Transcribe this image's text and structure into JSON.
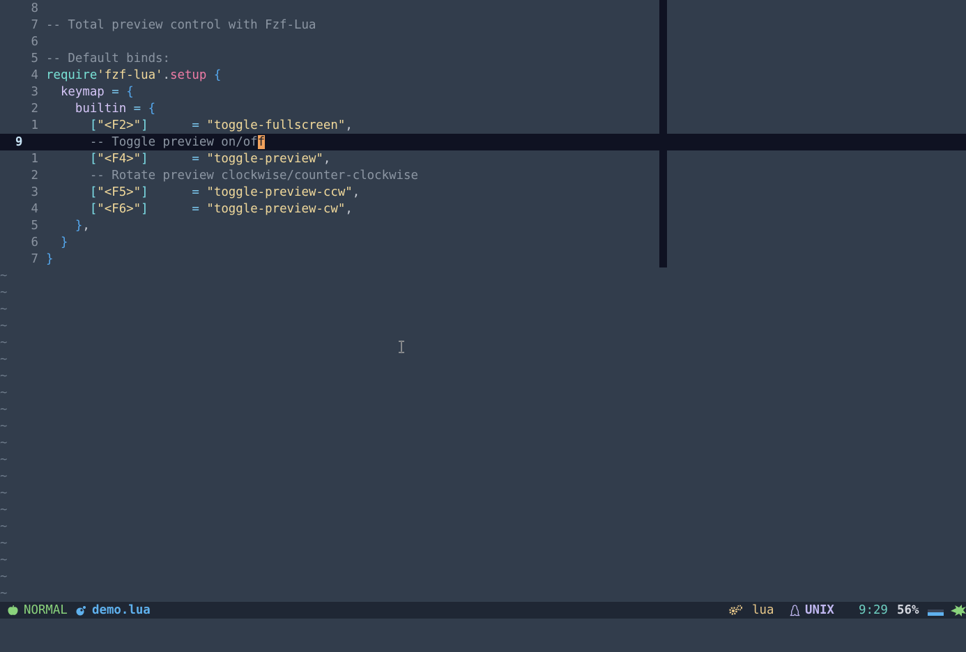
{
  "editor": {
    "lines": [
      {
        "num": "8",
        "segments": []
      },
      {
        "num": "7",
        "segments": [
          {
            "t": "-- Total preview control with Fzf-Lua",
            "c": "c-com"
          }
        ]
      },
      {
        "num": "6",
        "segments": []
      },
      {
        "num": "5",
        "segments": [
          {
            "t": "-- Default binds:",
            "c": "c-com"
          }
        ]
      },
      {
        "num": "4",
        "segments": [
          {
            "t": "require",
            "c": "c-kw"
          },
          {
            "t": "'fzf-lua'",
            "c": "c-str"
          },
          {
            "t": ".",
            "c": "c-pu"
          },
          {
            "t": "setup",
            "c": "c-fn"
          },
          {
            "t": " ",
            "c": "c-pu"
          },
          {
            "t": "{",
            "c": "c-br"
          }
        ]
      },
      {
        "num": "3",
        "segments": [
          {
            "t": "  keymap",
            "c": "c-var"
          },
          {
            "t": " = ",
            "c": "c-op"
          },
          {
            "t": "{",
            "c": "c-br"
          }
        ]
      },
      {
        "num": "2",
        "segments": [
          {
            "t": "    builtin",
            "c": "c-var"
          },
          {
            "t": " = ",
            "c": "c-op"
          },
          {
            "t": "{",
            "c": "c-br"
          }
        ]
      },
      {
        "num": "1",
        "segments": [
          {
            "t": "      [",
            "c": "c-bk"
          },
          {
            "t": "\"<F2>\"",
            "c": "c-str"
          },
          {
            "t": "]",
            "c": "c-bk"
          },
          {
            "t": "      = ",
            "c": "c-op"
          },
          {
            "t": "\"toggle-fullscreen\"",
            "c": "c-str"
          },
          {
            "t": ",",
            "c": "c-pu"
          }
        ]
      },
      {
        "num": "9",
        "current": true,
        "segments": [
          {
            "t": "      -- Toggle preview on/of",
            "c": "c-com"
          },
          {
            "t": "f",
            "c": "cursor"
          }
        ]
      },
      {
        "num": "1",
        "segments": [
          {
            "t": "      [",
            "c": "c-bk"
          },
          {
            "t": "\"<F4>\"",
            "c": "c-str"
          },
          {
            "t": "]",
            "c": "c-bk"
          },
          {
            "t": "      = ",
            "c": "c-op"
          },
          {
            "t": "\"toggle-preview\"",
            "c": "c-str"
          },
          {
            "t": ",",
            "c": "c-pu"
          }
        ]
      },
      {
        "num": "2",
        "segments": [
          {
            "t": "      -- Rotate preview clockwise/counter-clockwise",
            "c": "c-com"
          }
        ]
      },
      {
        "num": "3",
        "segments": [
          {
            "t": "      [",
            "c": "c-bk"
          },
          {
            "t": "\"<F5>\"",
            "c": "c-str"
          },
          {
            "t": "]",
            "c": "c-bk"
          },
          {
            "t": "      = ",
            "c": "c-op"
          },
          {
            "t": "\"toggle-preview-ccw\"",
            "c": "c-str"
          },
          {
            "t": ",",
            "c": "c-pu"
          }
        ]
      },
      {
        "num": "4",
        "segments": [
          {
            "t": "      [",
            "c": "c-bk"
          },
          {
            "t": "\"<F6>\"",
            "c": "c-str"
          },
          {
            "t": "]",
            "c": "c-bk"
          },
          {
            "t": "      = ",
            "c": "c-op"
          },
          {
            "t": "\"toggle-preview-cw\"",
            "c": "c-str"
          },
          {
            "t": ",",
            "c": "c-pu"
          }
        ]
      },
      {
        "num": "5",
        "segments": [
          {
            "t": "    }",
            "c": "c-br"
          },
          {
            "t": ",",
            "c": "c-pu"
          }
        ]
      },
      {
        "num": "6",
        "segments": [
          {
            "t": "  }",
            "c": "c-br"
          }
        ]
      },
      {
        "num": "7",
        "segments": [
          {
            "t": "}",
            "c": "c-br"
          }
        ]
      }
    ],
    "tilde_char": "~",
    "tilde_count": 20
  },
  "statusline": {
    "mode": "NORMAL",
    "filename": "demo.lua",
    "filetype": "lua",
    "fileformat": "UNIX",
    "position": "9:29",
    "percent": "56%",
    "scroll_fraction": 0.56
  },
  "colors": {
    "background": "#323d4c",
    "current_line": "#0f1222",
    "statusline_bg": "#1f2734",
    "mode": "#8ad37c",
    "filename": "#5fb1ee",
    "cursor": "#f0a15c"
  },
  "icons": {
    "mode": "apple-icon",
    "file": "lua-icon",
    "filetype": "gears-icon",
    "fileformat": "linux-icon",
    "end": "leaf-icon"
  }
}
